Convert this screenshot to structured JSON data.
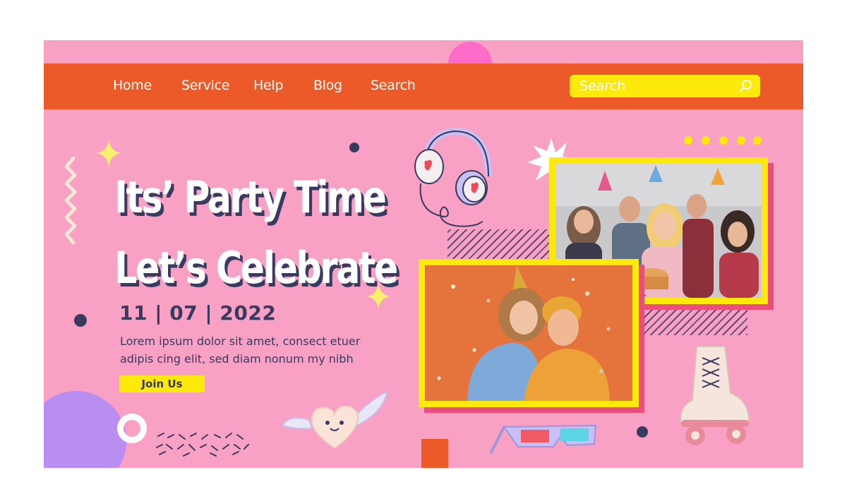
{
  "nav": {
    "links": [
      "Home",
      "Service",
      "Help",
      "Blog",
      "Search"
    ],
    "search_placeholder": "Search"
  },
  "hero": {
    "title_line1": "Its’ Party Time",
    "title_line2": "Let’s Celebrate",
    "date": "11 | 07 | 2022",
    "description_line1": "Lorem ipsum dolor sit amet, consect etuer",
    "description_line2": "adipis cing elit, sed diam nonum my nibh",
    "join_label": "Join Us"
  },
  "colors": {
    "background": "#f8a1c4",
    "navbar": "#eb5a28",
    "accent_yellow": "#fde90c",
    "text_dark": "#3a3a5e",
    "accent_pink": "#ff6bc8",
    "accent_purple": "#b98ef0"
  },
  "icons": [
    "search-icon",
    "sparkle-icon",
    "headphones-icon",
    "starburst-icon",
    "heart-with-wings-icon",
    "3d-glasses-icon",
    "roller-skate-icon"
  ]
}
